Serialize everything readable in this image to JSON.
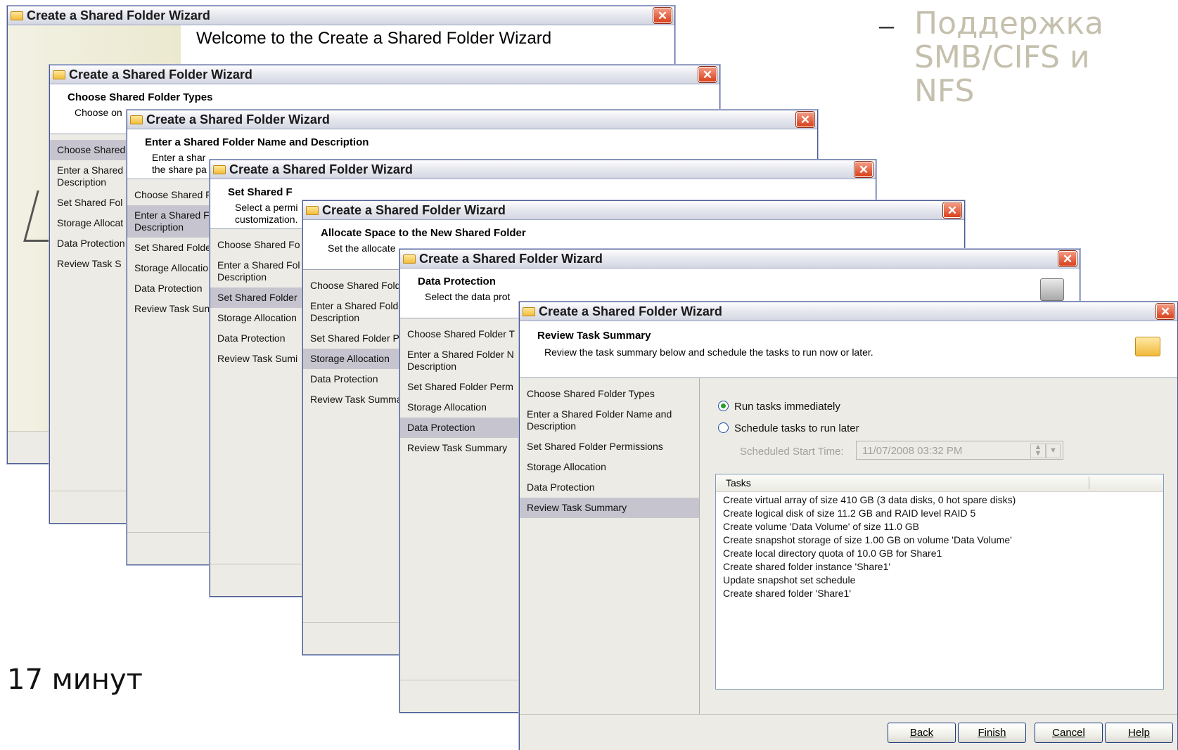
{
  "slide": {
    "bullet_dash": "–",
    "note_lines": [
      "Поддержка",
      "SMB/CIFS и",
      "NFS"
    ],
    "time_label": "17 минут"
  },
  "wizard_title": "Create a Shared Folder Wizard",
  "close_glyph": "✕",
  "win1": {
    "welcome": "Welcome to the Create a Shared Folder Wizard",
    "steps": [
      "Choose Share",
      "Enter a Shared\nDescription",
      "Set Shared Fo",
      "Storage Alloca",
      "Data Protectio",
      "Review Task S"
    ]
  },
  "win2": {
    "title": "Choose Shared Folder Types",
    "subtitle": "Choose on",
    "steps": [
      "Choose Shared",
      "Enter a Shared\nDescription",
      "Set Shared Fol",
      "Storage Allocat",
      "Data Protection",
      "Review Task S"
    ]
  },
  "win3": {
    "title": "Enter a Shared Folder Name and Description",
    "subtitle": "Enter a shar\nthe share pa",
    "steps": [
      "Choose Shared F",
      "Enter a Shared Fo\nDescription",
      "Set Shared Folde",
      "Storage Allocation",
      "Data Protection",
      "Review Task Sun"
    ]
  },
  "win4": {
    "title": "Set Shared F",
    "subtitle": "Select a permi\ncustomization.",
    "steps": [
      "Choose Shared Fo",
      "Enter a Shared Fol\nDescription",
      "Set Shared Folder",
      "Storage Allocation",
      "Data Protection",
      "Review Task Sumi"
    ]
  },
  "win5": {
    "title": "Allocate Space to the New Shared Folder",
    "subtitle": "Set the allocate",
    "steps": [
      "Choose Shared Folder T",
      "Enter a Shared Folder N\nDescription",
      "Set Shared Folder Perm",
      "Storage Allocation",
      "Data Protection",
      "Review Task Summary"
    ]
  },
  "win6": {
    "title": "Data Protection",
    "subtitle": "Select the data prot"
  },
  "main": {
    "header_title": "Review Task Summary",
    "header_subtitle": "Review the task summary below and schedule the tasks to run now or later.",
    "steps": [
      "Choose Shared Folder Types",
      "Enter a Shared Folder Name and\nDescription",
      "Set Shared Folder Permissions",
      "Storage Allocation",
      "Data Protection",
      "Review Task Summary"
    ],
    "run_immediately": "Run tasks immediately",
    "schedule_later": "Schedule tasks to run later",
    "start_time_label": "Scheduled Start Time:",
    "start_time_value": "11/07/2008 03:32 PM",
    "tasks_header": "Tasks",
    "tasks": [
      "Create virtual array of size 410 GB (3 data disks, 0 hot spare disks)",
      "Create logical disk of size 11.2 GB and RAID level RAID 5",
      "Create volume 'Data Volume' of size 11.0 GB",
      "Create snapshot storage of size 1.00 GB on volume 'Data Volume'",
      "Create local directory quota of 10.0 GB for Share1",
      "Create shared folder instance 'Share1'",
      "Update snapshot set schedule",
      "Create shared folder 'Share1'"
    ],
    "buttons": {
      "back": "Back",
      "finish": "Finish",
      "cancel": "Cancel",
      "help": "Help"
    }
  }
}
